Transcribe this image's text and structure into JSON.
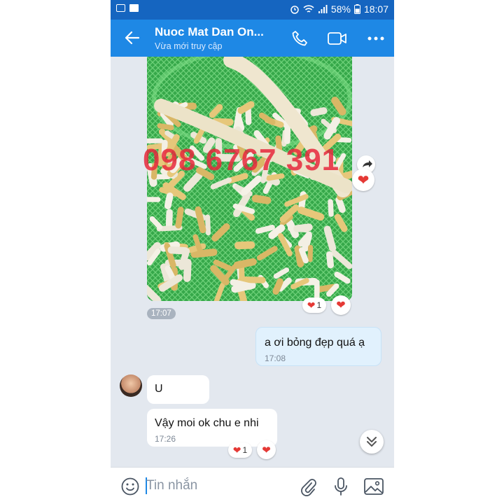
{
  "status_bar": {
    "battery_percent": "58%",
    "time": "18:07"
  },
  "header": {
    "title": "Nuoc Mat Dan On...",
    "subtitle": "Vừa mới truy cập"
  },
  "image_message": {
    "watermark": "098 6767 391",
    "time": "17:07",
    "reaction_count": "1"
  },
  "messages": [
    {
      "side": "right",
      "text": "a ơi bỏng đẹp quá ạ",
      "time": "17:08"
    },
    {
      "side": "left",
      "text": "U",
      "time": ""
    },
    {
      "side": "left",
      "text": "Vậy moi ok chu e nhi",
      "time": "17:26",
      "reaction_count": "1"
    }
  ],
  "composer": {
    "placeholder": "Tin nhắn"
  },
  "colors": {
    "header": "#1e88e5",
    "status": "#1565c0",
    "background": "#e3e8ef",
    "outgoing": "#e1f1fd",
    "heart": "#e53935"
  }
}
